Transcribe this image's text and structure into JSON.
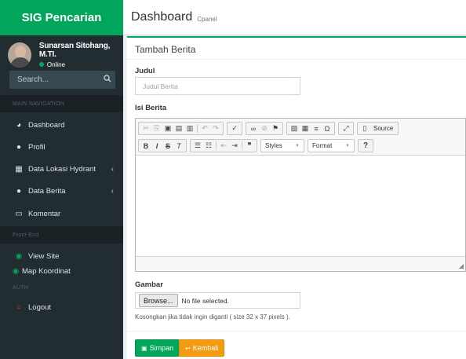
{
  "brand": "SIG Pencarian",
  "user": {
    "name": "Sunarsan Sitohang, M.TI.",
    "status": "Online"
  },
  "search": {
    "placeholder": "Search..."
  },
  "sections": {
    "main": "MAIN NAVIGATION",
    "frontend": "Front End",
    "auth": "AUTH"
  },
  "menu": {
    "dashboard": "Dashboard",
    "profil": "Profil",
    "hydrant": "Data Lokasi Hydrant",
    "berita": "Data Berita",
    "komentar": "Komentar",
    "view_site": "View Site",
    "map": "Map Koordinat",
    "logout": "Logout"
  },
  "header": {
    "title": "Dashboard",
    "subtitle": "Cpanel"
  },
  "box": {
    "title": "Tambah Berita"
  },
  "form": {
    "judul_label": "Judul",
    "judul_placeholder": "Judul Berita",
    "judul_value": "",
    "isi_label": "Isi Berita",
    "gambar_label": "Gambar",
    "browse_label": "Browse...",
    "file_status": "No file selected.",
    "help": "Kosongkan jika tidak ingin diganti ( size 32 x 37 pixels )."
  },
  "editor": {
    "source_label": "Source",
    "styles_label": "Styles",
    "format_label": "Format",
    "content": ""
  },
  "buttons": {
    "save": "Simpan",
    "back": "Kembali"
  },
  "colors": {
    "accent": "#00a65a",
    "sidebar": "#222d32",
    "warning": "#f39c12",
    "danger": "#dd4b39"
  },
  "icons": {
    "dashboard": "tachometer-icon",
    "profil": "users-icon",
    "hydrant": "building-icon",
    "berita": "globe-icon",
    "komentar": "laptop-icon",
    "view_site": "eye-icon",
    "map": "eye-icon",
    "logout": "circle-icon",
    "search": "search-icon",
    "save": "floppy-icon",
    "back": "reply-icon"
  }
}
